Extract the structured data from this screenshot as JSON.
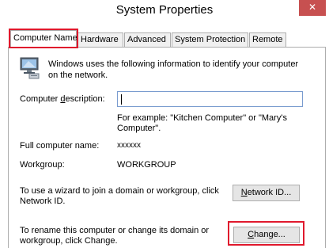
{
  "window": {
    "title": "System Properties",
    "close_label": "✕"
  },
  "tabs": [
    {
      "label": "Computer Name",
      "active": true
    },
    {
      "label": "Hardware",
      "active": false
    },
    {
      "label": "Advanced",
      "active": false
    },
    {
      "label": "System Protection",
      "active": false
    },
    {
      "label": "Remote",
      "active": false
    }
  ],
  "panel": {
    "intro_line1": "Windows uses the following information to identify your computer",
    "intro_line2": "on the network.",
    "description_label_pre": "Computer ",
    "description_label_accel": "d",
    "description_label_post": "escription:",
    "description_value": "",
    "example_line1": "For example: \"Kitchen Computer\" or \"Mary's",
    "example_line2": "Computer\".",
    "full_name_label": "Full computer name:",
    "full_name_value": "xxxxxx",
    "workgroup_label": "Workgroup:",
    "workgroup_value": "WORKGROUP",
    "network_text_line1": "To use a wizard to join a domain or workgroup, click",
    "network_text_line2": "Network ID.",
    "network_button_accel": "N",
    "network_button_rest": "etwork ID...",
    "change_text_line1": "To rename this computer or change its domain or",
    "change_text_line2": "workgroup, click Change.",
    "change_button_accel": "C",
    "change_button_rest": "hange..."
  },
  "colors": {
    "highlight": "#e0192d",
    "close_button": "#c75050",
    "input_border": "#7a9ccf"
  },
  "icons": {
    "computer": "computer-monitor-icon"
  }
}
